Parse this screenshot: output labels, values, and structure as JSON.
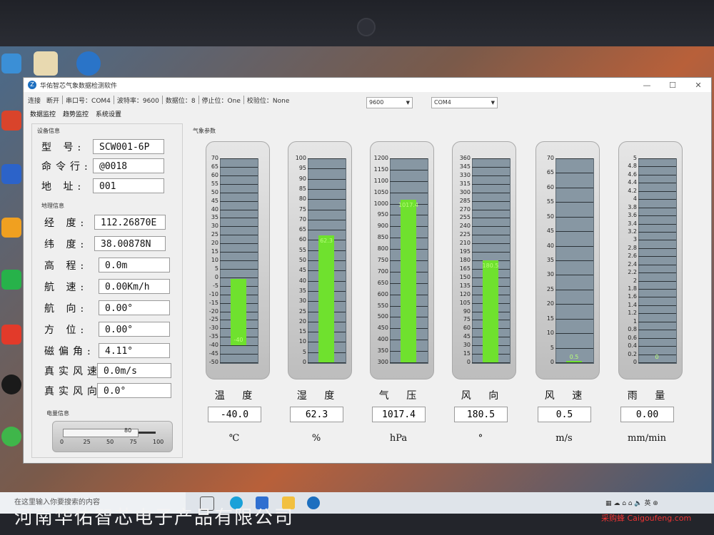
{
  "window": {
    "title": "华佑智芯气象数据检测软件"
  },
  "toolbar": {
    "connect": "连接",
    "disconnect": "断开",
    "port": "串口号：COM4",
    "baud": "波特率：9600",
    "databits": "数据位：8",
    "stopbits": "停止位：One",
    "parity": "校验位：None",
    "baud_select": "9600",
    "port_select": "COM4"
  },
  "menu": {
    "items": [
      "数据监控",
      "趋势监控",
      "系统设置"
    ]
  },
  "device": {
    "title": "设备信息",
    "fields": [
      {
        "label": "型 号:",
        "value": "SCW001-6P"
      },
      {
        "label": "命令行:",
        "value": "@0018"
      },
      {
        "label": "地 址:",
        "value": "001"
      }
    ]
  },
  "geo": {
    "title": "地理信息",
    "fields": [
      {
        "label": "经 度:",
        "value": "112.26870E"
      },
      {
        "label": "纬 度:",
        "value": "38.00878N"
      },
      {
        "label": "高 程:",
        "value": "0.0m"
      },
      {
        "label": "航 速:",
        "value": "0.00Km/h"
      },
      {
        "label": "航 向:",
        "value": "0.00°"
      },
      {
        "label": "方 位:",
        "value": "0.00°"
      },
      {
        "label": "磁偏角:",
        "value": "4.11°"
      },
      {
        "label": "真实风速:",
        "value": "0.0m/s"
      },
      {
        "label": "真实风向:",
        "value": "0.0°"
      }
    ]
  },
  "power": {
    "title": "电量信息",
    "ticks": [
      "0",
      "25",
      "50",
      "75",
      "100"
    ],
    "value": 80,
    "value_label": "80"
  },
  "weather": {
    "title": "气象参数",
    "gauges": [
      {
        "name": "温 度",
        "value": "-40.0",
        "unit": "℃",
        "bar_label": "-40",
        "min": -50,
        "max": 70,
        "ticks": [
          "70",
          "65",
          "60",
          "55",
          "50",
          "45",
          "40",
          "35",
          "30",
          "25",
          "20",
          "15",
          "10",
          "5",
          "0",
          "-5",
          "-10",
          "-15",
          "-20",
          "-25",
          "-30",
          "-35",
          "-40",
          "-45",
          "-50"
        ],
        "bar_from": -40,
        "bar_to": -1
      },
      {
        "name": "湿 度",
        "value": "62.3",
        "unit": "%",
        "bar_label": "62.3",
        "min": 0,
        "max": 100,
        "ticks": [
          "100",
          "95",
          "90",
          "85",
          "80",
          "75",
          "70",
          "65",
          "60",
          "55",
          "50",
          "45",
          "40",
          "35",
          "30",
          "25",
          "20",
          "15",
          "10",
          "5",
          "0"
        ],
        "bar_from": 0,
        "bar_to": 62.3
      },
      {
        "name": "气 压",
        "value": "1017.4",
        "unit": "hPa",
        "bar_label": "1017.4",
        "min": 300,
        "max": 1200,
        "ticks": [
          "1200",
          "1150",
          "1100",
          "1050",
          "1000",
          "950",
          "900",
          "850",
          "800",
          "750",
          "700",
          "650",
          "600",
          "550",
          "500",
          "450",
          "400",
          "350",
          "300"
        ],
        "bar_from": 300,
        "bar_to": 1017.4
      },
      {
        "name": "风 向",
        "value": "180.5",
        "unit": "°",
        "bar_label": "180.5",
        "min": 0,
        "max": 360,
        "ticks": [
          "360",
          "345",
          "330",
          "315",
          "300",
          "285",
          "270",
          "255",
          "240",
          "225",
          "210",
          "195",
          "180",
          "165",
          "150",
          "135",
          "120",
          "105",
          "90",
          "75",
          "60",
          "45",
          "30",
          "15",
          "0"
        ],
        "bar_from": 0,
        "bar_to": 180.5
      },
      {
        "name": "风 速",
        "value": "0.5",
        "unit": "m/s",
        "bar_label": "0.5",
        "min": 0,
        "max": 70,
        "ticks": [
          "70",
          "65",
          "60",
          "55",
          "50",
          "45",
          "40",
          "35",
          "30",
          "25",
          "20",
          "15",
          "10",
          "5",
          "0"
        ],
        "bar_from": 0,
        "bar_to": 0.5
      },
      {
        "name": "雨 量",
        "value": "0.00",
        "unit": "mm/min",
        "bar_label": "0",
        "min": 0,
        "max": 5,
        "ticks": [
          "5",
          "4.8",
          "4.6",
          "4.4",
          "4.2",
          "4",
          "3.8",
          "3.6",
          "3.4",
          "3.2",
          "3",
          "2.8",
          "2.6",
          "2.4",
          "2.2",
          "2",
          "1.8",
          "1.6",
          "1.4",
          "1.2",
          "1",
          "0.8",
          "0.6",
          "0.4",
          "0.2",
          "0"
        ],
        "bar_from": 0,
        "bar_to": 0
      }
    ]
  },
  "taskbar": {
    "search_placeholder": "在这里输入你要搜索的内容"
  },
  "overlay": {
    "watermark": "河南华佑智芯电子产品有限公司",
    "brand": "采购蜂 Caigoufeng.com"
  },
  "colors": {
    "bar": "#6fe12e",
    "bar_label": "#b8ff7a",
    "gauge_bg": "#8797a3",
    "title_icon": "#1d6fbf"
  }
}
